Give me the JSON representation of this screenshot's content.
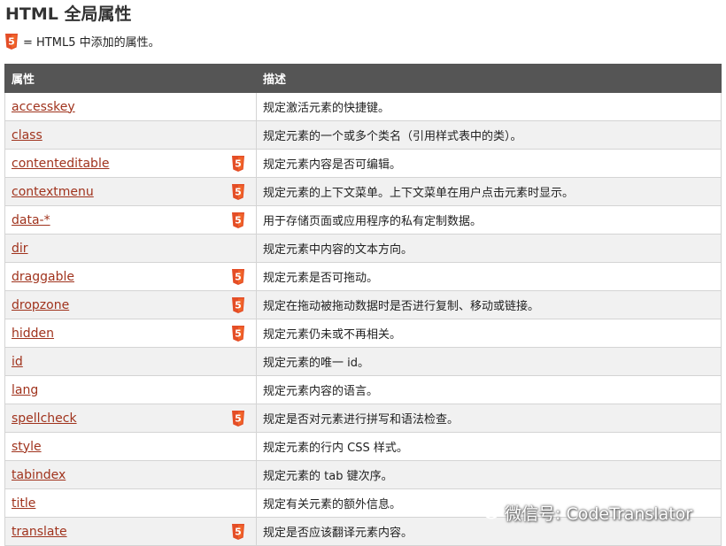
{
  "page": {
    "title": "HTML 全局属性",
    "legend_text": "= HTML5 中添加的属性。"
  },
  "table": {
    "headers": [
      "属性",
      "描述"
    ],
    "rows": [
      {
        "attr": "accesskey",
        "html5": false,
        "desc": "规定激活元素的快捷键。"
      },
      {
        "attr": "class",
        "html5": false,
        "desc": "规定元素的一个或多个类名（引用样式表中的类）。"
      },
      {
        "attr": "contenteditable",
        "html5": true,
        "desc": "规定元素内容是否可编辑。"
      },
      {
        "attr": "contextmenu",
        "html5": true,
        "desc": "规定元素的上下文菜单。上下文菜单在用户点击元素时显示。"
      },
      {
        "attr": "data-*",
        "html5": true,
        "desc": "用于存储页面或应用程序的私有定制数据。"
      },
      {
        "attr": "dir",
        "html5": false,
        "desc": "规定元素中内容的文本方向。"
      },
      {
        "attr": "draggable",
        "html5": true,
        "desc": "规定元素是否可拖动。"
      },
      {
        "attr": "dropzone",
        "html5": true,
        "desc": "规定在拖动被拖动数据时是否进行复制、移动或链接。"
      },
      {
        "attr": "hidden",
        "html5": true,
        "desc": "规定元素仍未或不再相关。"
      },
      {
        "attr": "id",
        "html5": false,
        "desc": "规定元素的唯一 id。"
      },
      {
        "attr": "lang",
        "html5": false,
        "desc": "规定元素内容的语言。"
      },
      {
        "attr": "spellcheck",
        "html5": true,
        "desc": "规定是否对元素进行拼写和语法检查。"
      },
      {
        "attr": "style",
        "html5": false,
        "desc": "规定元素的行内 CSS 样式。"
      },
      {
        "attr": "tabindex",
        "html5": false,
        "desc": "规定元素的 tab 键次序。"
      },
      {
        "attr": "title",
        "html5": false,
        "desc": "规定有关元素的额外信息。"
      },
      {
        "attr": "translate",
        "html5": true,
        "desc": "规定是否应该翻译元素内容。"
      }
    ]
  },
  "watermark": {
    "text": "微信号: CodeTranslator",
    "icon": "wechat-icon"
  },
  "colors": {
    "header_bg": "#555555",
    "link": "#a0331d",
    "html5_badge": "#e44d26",
    "row_alt": "#f1f1f1"
  }
}
